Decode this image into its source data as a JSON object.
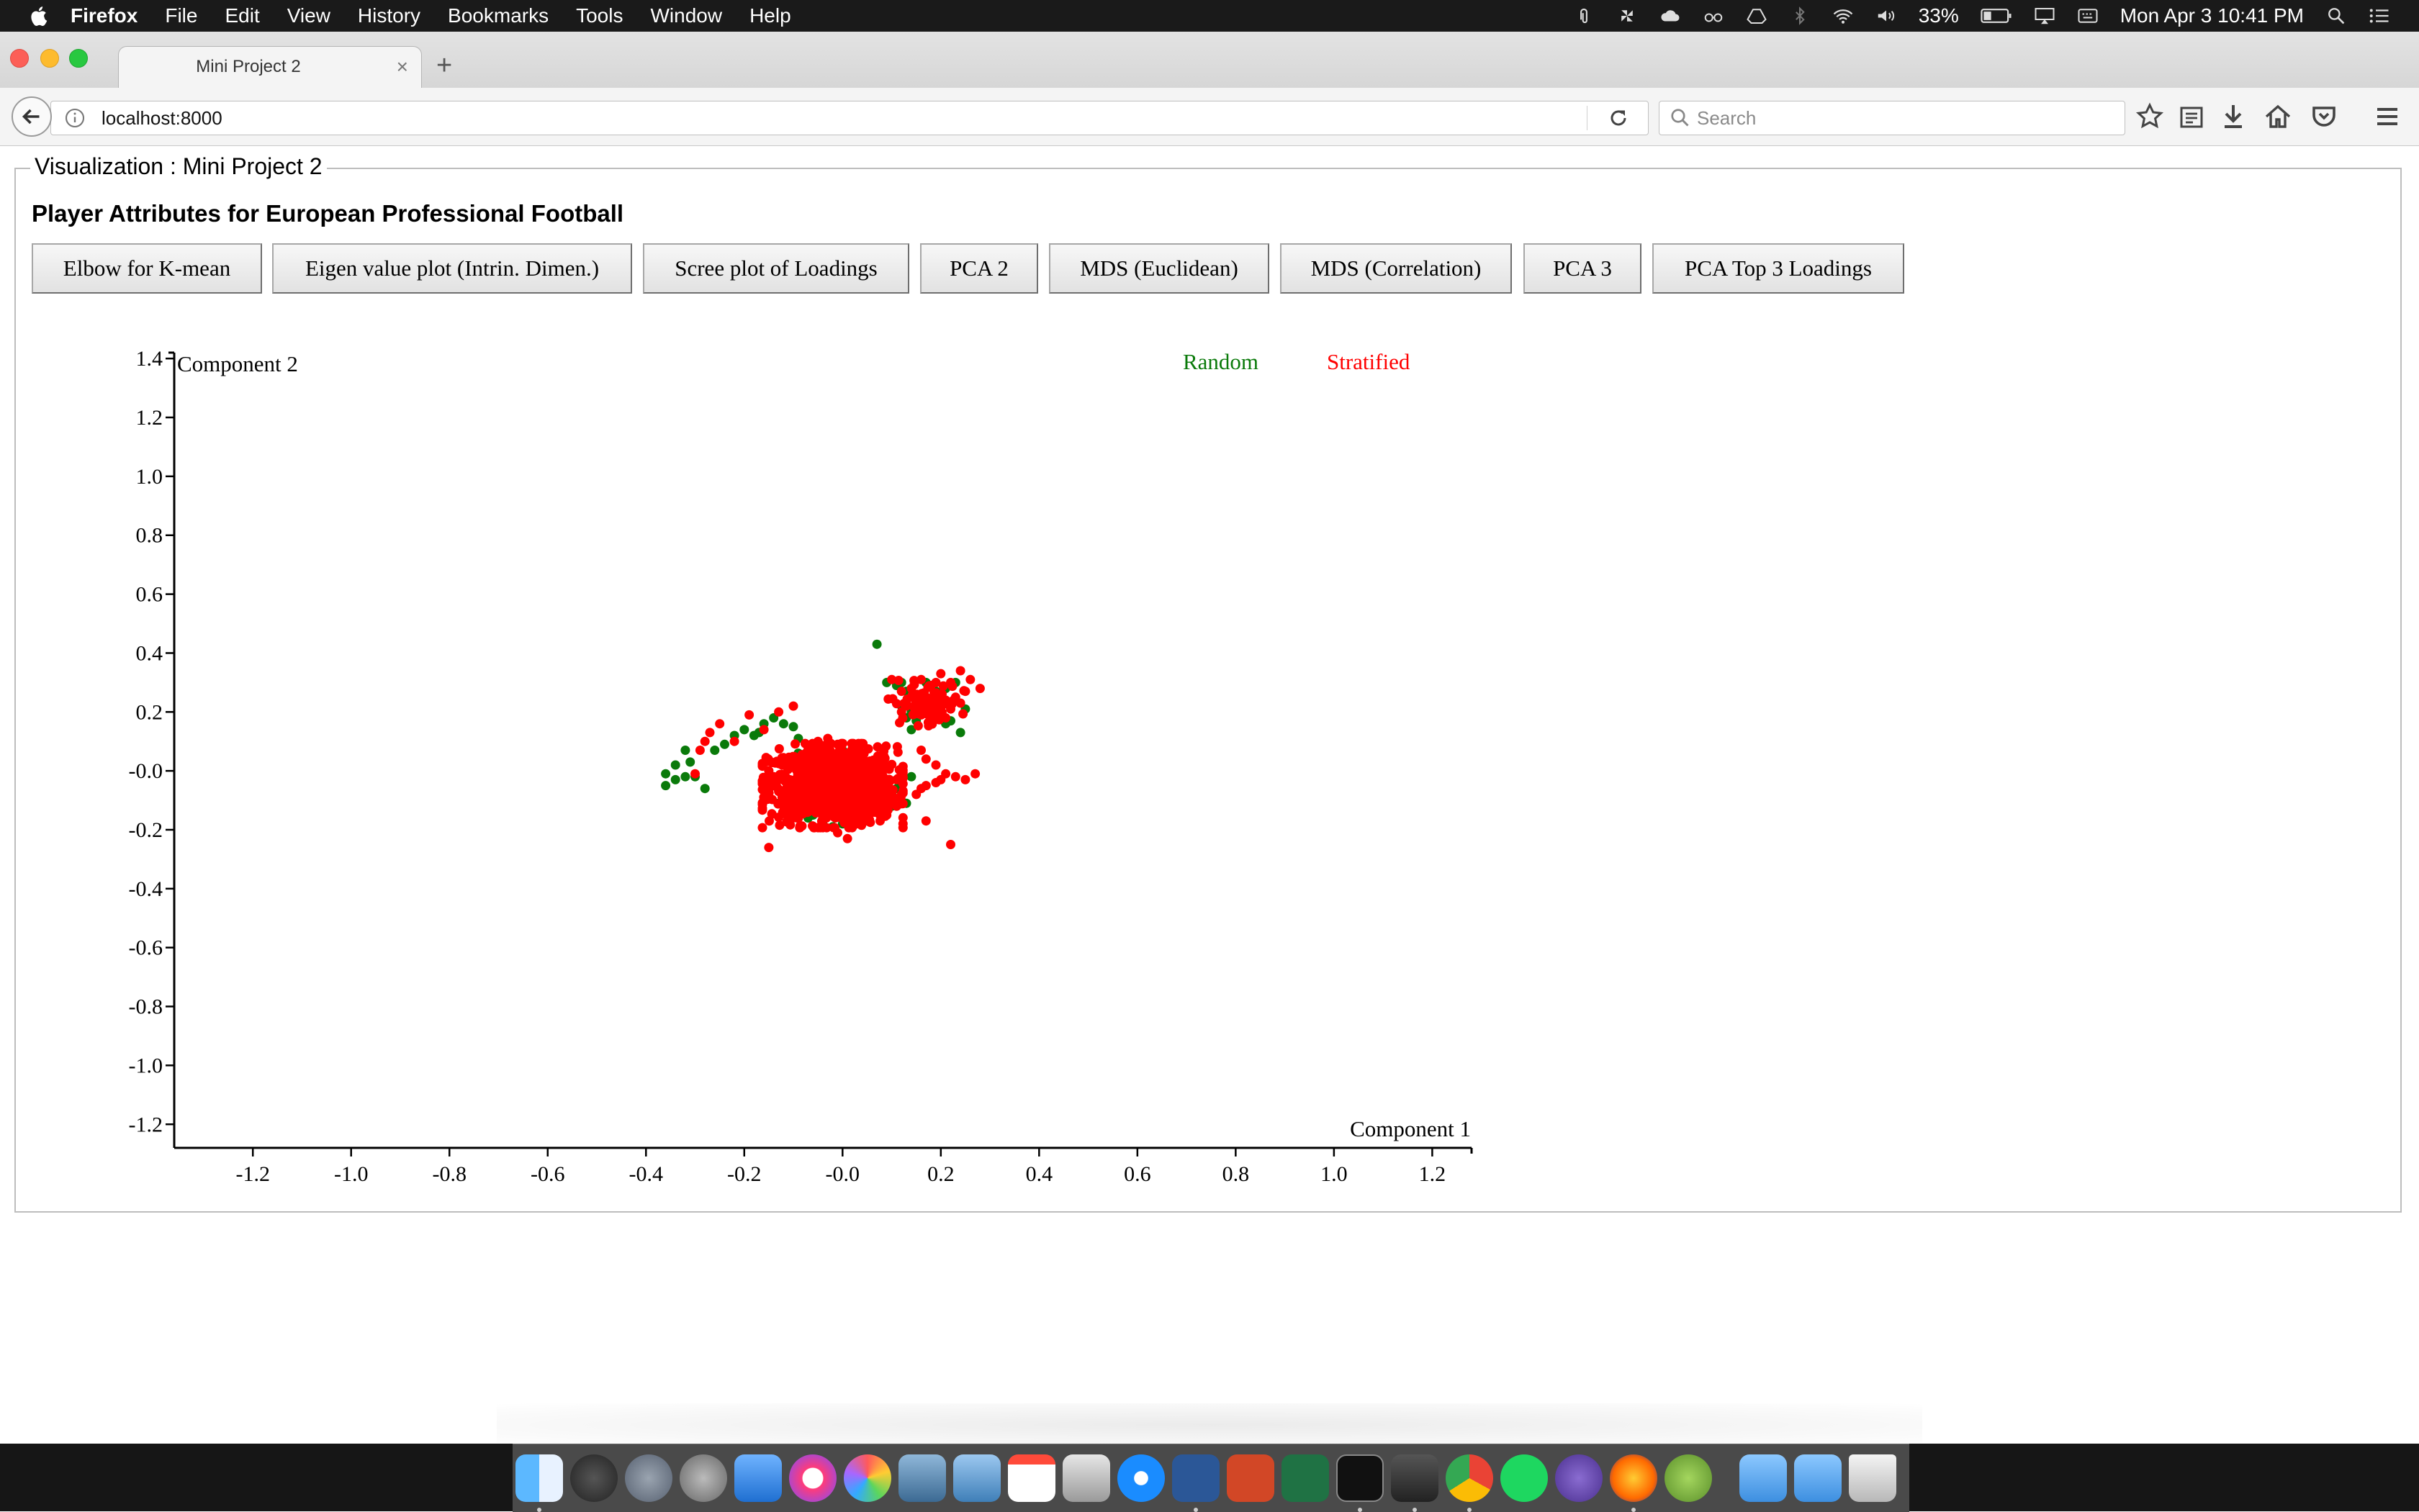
{
  "menubar": {
    "app_name": "Firefox",
    "items": [
      "File",
      "Edit",
      "View",
      "History",
      "Bookmarks",
      "Tools",
      "Window",
      "Help"
    ],
    "battery": "33%",
    "datetime": "Mon Apr 3  10:41 PM"
  },
  "browser": {
    "tab_title": "Mini Project 2",
    "tab_close": "×",
    "new_tab": "+",
    "url": "localhost:8000",
    "search_placeholder": "Search"
  },
  "page": {
    "fieldset_legend": "Visualization : Mini Project 2",
    "title": "Player Attributes for European Professional Football",
    "buttons": [
      {
        "label": "Elbow for K-mean"
      },
      {
        "label": "Eigen value plot (Intrin. Dimen.)"
      },
      {
        "label": "Scree plot of Loadings"
      },
      {
        "label": "PCA 2"
      },
      {
        "label": "MDS (Euclidean)"
      },
      {
        "label": "MDS (Correlation)"
      },
      {
        "label": "PCA 3"
      },
      {
        "label": "PCA Top 3 Loadings"
      }
    ]
  },
  "chart_data": {
    "type": "scatter",
    "title": "",
    "xlabel": "Component 1",
    "ylabel": "Component 2",
    "xlim": [
      -1.36,
      1.28
    ],
    "ylim": [
      -1.28,
      1.42
    ],
    "xticks": [
      -1.2,
      -1.0,
      -0.8,
      -0.6,
      -0.4,
      -0.2,
      0.0,
      0.2,
      0.4,
      0.6,
      0.8,
      1.0,
      1.2
    ],
    "xtick_labels": [
      "-1.2",
      "-1.0",
      "-0.8",
      "-0.6",
      "-0.4",
      "-0.2",
      "-0.0",
      "0.2",
      "0.4",
      "0.6",
      "0.8",
      "1.0",
      "1.2"
    ],
    "yticks": [
      1.4,
      1.2,
      1.0,
      0.8,
      0.6,
      0.4,
      0.2,
      0.0,
      -0.2,
      -0.4,
      -0.6,
      -0.8,
      -1.0,
      -1.2
    ],
    "ytick_labels": [
      "1.4",
      "1.2",
      "1.0",
      "0.8",
      "0.6",
      "0.4",
      "0.2",
      "-0.0",
      "-0.2",
      "-0.4",
      "-0.6",
      "-0.8",
      "-1.0",
      "-1.2"
    ],
    "grid": false,
    "legend_position": "top-right",
    "series": [
      {
        "name": "Random",
        "color": "#0a7a0a",
        "points": [
          [
            -0.36,
            -0.05
          ],
          [
            -0.34,
            -0.03
          ],
          [
            -0.32,
            -0.02
          ],
          [
            -0.3,
            -0.02
          ],
          [
            -0.28,
            -0.06
          ],
          [
            -0.36,
            -0.01
          ],
          [
            -0.32,
            0.07
          ],
          [
            -0.24,
            0.09
          ],
          [
            -0.22,
            0.12
          ],
          [
            -0.2,
            0.14
          ],
          [
            -0.18,
            0.12
          ],
          [
            -0.16,
            0.16
          ],
          [
            -0.14,
            0.18
          ],
          [
            -0.12,
            0.16
          ],
          [
            -0.1,
            0.15
          ],
          [
            -0.09,
            0.11
          ],
          [
            -0.17,
            0.13
          ],
          [
            -0.26,
            0.07
          ],
          [
            -0.31,
            0.03
          ],
          [
            -0.34,
            0.02
          ],
          [
            -0.14,
            -0.05
          ],
          [
            -0.12,
            -0.08
          ],
          [
            -0.1,
            -0.1
          ],
          [
            -0.08,
            -0.12
          ],
          [
            -0.06,
            -0.15
          ],
          [
            -0.04,
            -0.17
          ],
          [
            -0.02,
            -0.19
          ],
          [
            0.0,
            -0.18
          ],
          [
            0.02,
            -0.16
          ],
          [
            0.04,
            -0.15
          ],
          [
            0.06,
            -0.12
          ],
          [
            0.08,
            -0.1
          ],
          [
            0.1,
            -0.08
          ],
          [
            0.12,
            -0.04
          ],
          [
            0.14,
            -0.02
          ],
          [
            0.1,
            -0.12
          ],
          [
            0.08,
            -0.15
          ],
          [
            -0.12,
            -0.02
          ],
          [
            -0.11,
            0.03
          ],
          [
            -0.09,
            0.06
          ],
          [
            -0.06,
            0.08
          ],
          [
            -0.03,
            0.09
          ],
          [
            0.0,
            0.07
          ],
          [
            0.03,
            0.05
          ],
          [
            0.06,
            0.03
          ],
          [
            0.09,
            0.01
          ],
          [
            0.11,
            -0.06
          ],
          [
            -0.13,
            -0.11
          ],
          [
            -0.07,
            -0.16
          ],
          [
            0.05,
            -0.17
          ],
          [
            0.13,
            -0.11
          ],
          [
            0.12,
            0.0
          ],
          [
            0.07,
            0.43
          ],
          [
            0.09,
            0.3
          ],
          [
            0.11,
            0.29
          ],
          [
            0.12,
            0.22
          ],
          [
            0.13,
            0.18
          ],
          [
            0.14,
            0.2
          ],
          [
            0.15,
            0.17
          ],
          [
            0.16,
            0.22
          ],
          [
            0.17,
            0.25
          ],
          [
            0.18,
            0.19
          ],
          [
            0.19,
            0.27
          ],
          [
            0.2,
            0.22
          ],
          [
            0.21,
            0.28
          ],
          [
            0.22,
            0.17
          ],
          [
            0.23,
            0.3
          ],
          [
            0.24,
            0.13
          ],
          [
            0.13,
            0.27
          ],
          [
            0.12,
            0.3
          ],
          [
            0.17,
            0.3
          ],
          [
            0.25,
            0.21
          ],
          [
            0.14,
            0.14
          ],
          [
            0.21,
            0.16
          ]
        ]
      },
      {
        "name": "Stratified",
        "color": "#ff0000",
        "points": [
          [
            -0.28,
            0.1
          ],
          [
            -0.27,
            0.13
          ],
          [
            -0.25,
            0.16
          ],
          [
            -0.19,
            0.19
          ],
          [
            -0.13,
            0.2
          ],
          [
            -0.1,
            0.22
          ],
          [
            -0.29,
            0.07
          ],
          [
            -0.3,
            -0.01
          ],
          [
            -0.16,
            0.14
          ],
          [
            -0.22,
            0.1
          ],
          [
            -0.15,
            -0.26
          ],
          [
            0.22,
            -0.25
          ],
          [
            0.27,
            -0.01
          ],
          [
            0.25,
            -0.03
          ],
          [
            0.23,
            -0.02
          ],
          [
            0.21,
            -0.01
          ],
          [
            0.2,
            -0.03
          ],
          [
            0.19,
            -0.04
          ],
          [
            0.17,
            -0.05
          ],
          [
            0.16,
            -0.06
          ],
          [
            0.15,
            -0.08
          ],
          [
            0.17,
            -0.17
          ],
          [
            0.19,
            0.02
          ],
          [
            0.17,
            0.04
          ],
          [
            0.16,
            0.07
          ],
          [
            0.1,
            0.31
          ],
          [
            0.12,
            0.27
          ],
          [
            0.14,
            0.28
          ],
          [
            0.16,
            0.31
          ],
          [
            0.18,
            0.29
          ],
          [
            0.2,
            0.33
          ],
          [
            0.22,
            0.3
          ],
          [
            0.24,
            0.34
          ],
          [
            0.26,
            0.31
          ],
          [
            0.28,
            0.28
          ],
          [
            0.2,
            0.26
          ],
          [
            0.21,
            0.24
          ],
          [
            0.19,
            0.22
          ],
          [
            0.22,
            0.21
          ],
          [
            0.23,
            0.25
          ],
          [
            0.25,
            0.27
          ],
          [
            0.18,
            0.24
          ],
          [
            0.17,
            0.21
          ],
          [
            0.15,
            0.23
          ],
          [
            0.14,
            0.25
          ],
          [
            0.16,
            0.19
          ],
          [
            0.18,
            0.18
          ],
          [
            0.2,
            0.2
          ],
          [
            0.13,
            0.22
          ],
          [
            0.12,
            0.2
          ],
          [
            0.24,
            0.23
          ],
          [
            0.21,
            0.18
          ],
          [
            0.19,
            0.3
          ],
          [
            -0.14,
            -0.02
          ],
          [
            -0.12,
            0.02
          ],
          [
            -0.1,
            -0.1
          ],
          [
            -0.08,
            -0.14
          ],
          [
            -0.07,
            0.08
          ],
          [
            -0.05,
            0.1
          ],
          [
            -0.03,
            0.11
          ],
          [
            -0.01,
            0.09
          ],
          [
            0.01,
            0.06
          ],
          [
            0.03,
            0.04
          ],
          [
            0.05,
            -0.02
          ],
          [
            0.07,
            -0.04
          ],
          [
            0.09,
            -0.07
          ],
          [
            0.1,
            -0.1
          ],
          [
            0.11,
            -0.12
          ],
          [
            0.08,
            -0.14
          ],
          [
            0.05,
            -0.16
          ],
          [
            0.02,
            -0.18
          ],
          [
            -0.01,
            -0.21
          ],
          [
            0.01,
            -0.23
          ],
          [
            -0.04,
            -0.16
          ],
          [
            -0.09,
            -0.06
          ],
          [
            -0.11,
            -0.05
          ],
          [
            -0.13,
            -0.07
          ],
          [
            -0.06,
            0.04
          ],
          [
            -0.03,
            0.02
          ],
          [
            0.0,
            0.01
          ],
          [
            0.04,
            0.01
          ],
          [
            0.12,
            -0.08
          ],
          [
            0.11,
            -0.03
          ],
          [
            -0.12,
            -0.12
          ],
          [
            -0.1,
            -0.14
          ],
          [
            0.06,
            -0.14
          ],
          [
            0.09,
            -0.15
          ],
          [
            -0.02,
            -0.13
          ],
          [
            -0.07,
            -0.11
          ],
          [
            0.03,
            -0.11
          ],
          [
            -0.05,
            -0.01
          ],
          [
            0.02,
            -0.06
          ],
          [
            -0.08,
            0.02
          ],
          [
            0.07,
            0.01
          ],
          [
            -0.15,
            0.0
          ]
        ],
        "dense_clusters": [
          {
            "center": [
              -0.02,
              -0.05
            ],
            "spread": [
              0.065,
              0.065
            ],
            "count": 950
          },
          {
            "center": [
              0.17,
              0.23
            ],
            "spread": [
              0.035,
              0.035
            ],
            "count": 70
          }
        ]
      }
    ]
  }
}
